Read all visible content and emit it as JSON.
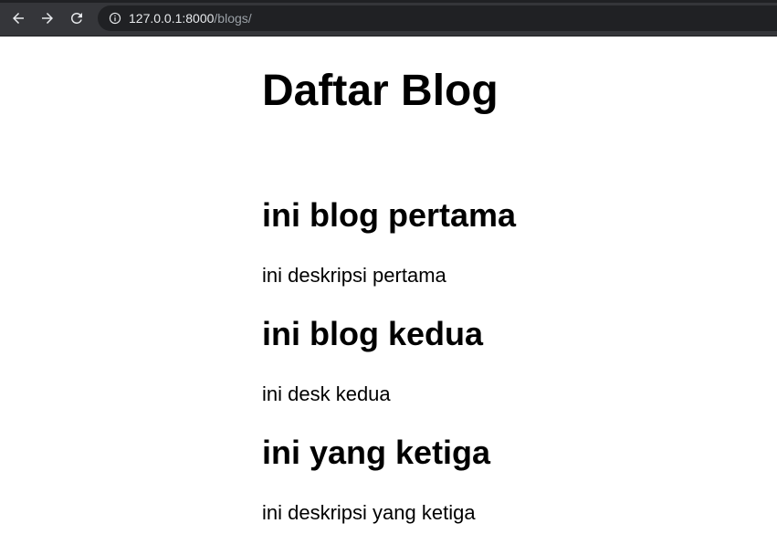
{
  "browser": {
    "url_host": "127.0.0.1:8000",
    "url_path": "/blogs/"
  },
  "page": {
    "title": "Daftar Blog"
  },
  "posts": [
    {
      "title": "ini blog pertama",
      "description": "ini deskripsi pertama"
    },
    {
      "title": "ini blog kedua",
      "description": "ini desk kedua"
    },
    {
      "title": "ini yang ketiga",
      "description": "ini deskripsi yang ketiga"
    }
  ]
}
